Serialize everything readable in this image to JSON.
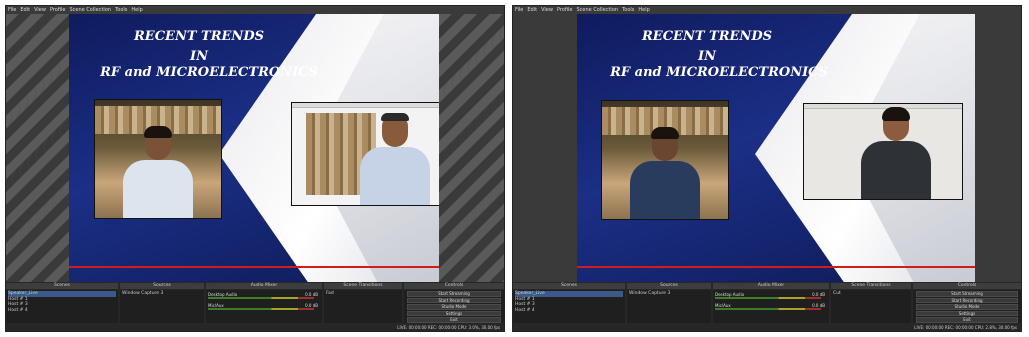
{
  "menu": [
    "File",
    "Edit",
    "View",
    "Profile",
    "Scene Collection",
    "Tools",
    "Help"
  ],
  "slide": {
    "line1": "RECENT TRENDS",
    "line2": "IN",
    "line3": "RF and MICROELECTRONICS",
    "accent": "#d21b1b",
    "background": "#13226b"
  },
  "docks": {
    "scenes": "Scenes",
    "sources": "Sources",
    "audio_mixer": "Audio Mixer",
    "scene_transitions": "Scene Transitions",
    "controls": "Controls"
  },
  "windows": [
    {
      "scenes": [
        "Speaker_Live",
        "Host # 1",
        "Host # 3",
        "Host # 4"
      ],
      "source": "Window Capture 3",
      "mixer": [
        {
          "name": "Desktop Audio",
          "db": "0.0 dB"
        },
        {
          "name": "Mic/Aux",
          "db": "0.0 dB"
        }
      ],
      "transition": "Fad",
      "controls": [
        "Start Streaming",
        "Start Recording",
        "Studio Mode",
        "Settings",
        "Exit"
      ],
      "status": "LIVE: 00:00:00   REC: 00:00:00   CPU: 3.0%, 30.00 fps"
    },
    {
      "scenes": [
        "Speaker_Live",
        "Host # 1",
        "Host # 3",
        "Host # 4"
      ],
      "source": "Window Capture 3",
      "mixer": [
        {
          "name": "Desktop Audio",
          "db": "0.0 dB"
        },
        {
          "name": "Mic/Aux",
          "db": "0.0 dB"
        }
      ],
      "transition": "Cut",
      "controls": [
        "Start Streaming",
        "Start Recording",
        "Studio Mode",
        "Settings",
        "Exit"
      ],
      "status": "LIVE: 00:00:00   REC: 00:00:00   CPU: 2.8%, 30.00 fps"
    }
  ]
}
